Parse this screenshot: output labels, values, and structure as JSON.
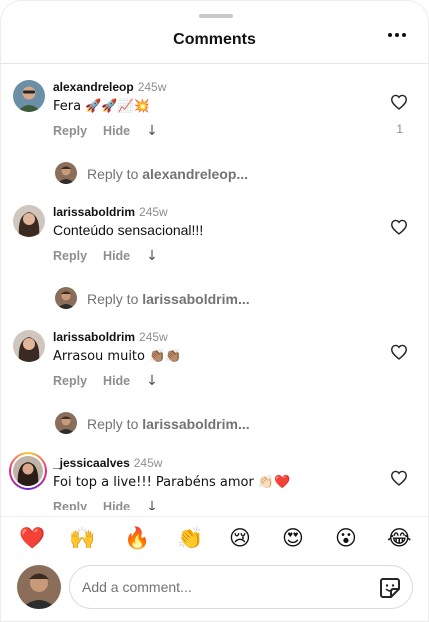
{
  "header": {
    "title": "Comments"
  },
  "comments": [
    {
      "username": "alexandreleop",
      "time": "245w",
      "text": "Fera 🚀🚀📈💥",
      "reply_label": "Reply",
      "hide_label": "Hide",
      "likes": "1",
      "reply_prompt_prefix": "Reply to",
      "reply_prompt_user": "alexandreleop..."
    },
    {
      "username": "larissaboldrim",
      "time": "245w",
      "text": "Conteúdo sensacional!!!",
      "reply_label": "Reply",
      "hide_label": "Hide",
      "reply_prompt_prefix": "Reply to",
      "reply_prompt_user": "larissaboldrim..."
    },
    {
      "username": "larissaboldrim",
      "time": "245w",
      "text": "Arrasou muito 👏🏽👏🏽",
      "reply_label": "Reply",
      "hide_label": "Hide",
      "reply_prompt_prefix": "Reply to",
      "reply_prompt_user": "larissaboldrim..."
    },
    {
      "username": "_jessicaalves",
      "time": "245w",
      "text": "Foi top a live!!! Parabéns amor 👏🏻❤️",
      "reply_label": "Reply",
      "hide_label": "Hide"
    }
  ],
  "reactions": [
    "❤️",
    "🙌",
    "🔥",
    "👏",
    "😢",
    "😍",
    "😮",
    "😂"
  ],
  "composer": {
    "placeholder": "Add a comment..."
  },
  "colors": {
    "heart_red": "#ed4956",
    "muted": "#8e8e8e",
    "ring": "#ee2a7b"
  },
  "icons": [
    "more-icon",
    "heart-outline-icon",
    "down-arrow-icon",
    "sticker-icon"
  ]
}
